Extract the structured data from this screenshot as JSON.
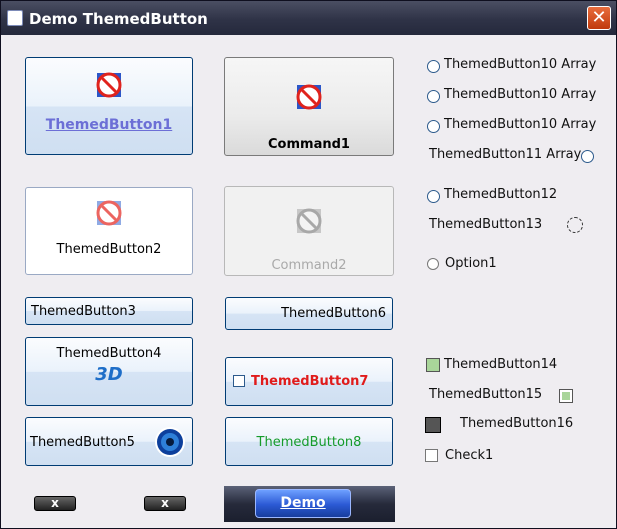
{
  "window": {
    "title": "Demo ThemedButton",
    "close_glyph": "✕"
  },
  "buttons": {
    "b1": "ThemedButton1",
    "cmd1": "Command1",
    "b2": "ThemedButton2",
    "cmd2": "Command2",
    "b3": "ThemedButton3",
    "b6": "ThemedButton6",
    "b4": "ThemedButton4",
    "b4_icon_text": "3D",
    "b7": "ThemedButton7",
    "b5": "ThemedButton5",
    "b8": "ThemedButton8",
    "demo": "Demo",
    "x1": "x",
    "x2": "x"
  },
  "options": {
    "arr10": [
      "ThemedButton10 Array",
      "ThemedButton10 Array",
      "ThemedButton10 Array"
    ],
    "arr11": "ThemedButton11 Array",
    "b12": "ThemedButton12",
    "b13": "ThemedButton13",
    "opt1": "Option1",
    "b14": "ThemedButton14",
    "b15": "ThemedButton15",
    "b16": "ThemedButton16",
    "chk1": "Check1"
  },
  "colors": {
    "b1_text": "#6c6fd6",
    "b7_text": "#e01b1b",
    "b8_text": "#159b2a"
  }
}
